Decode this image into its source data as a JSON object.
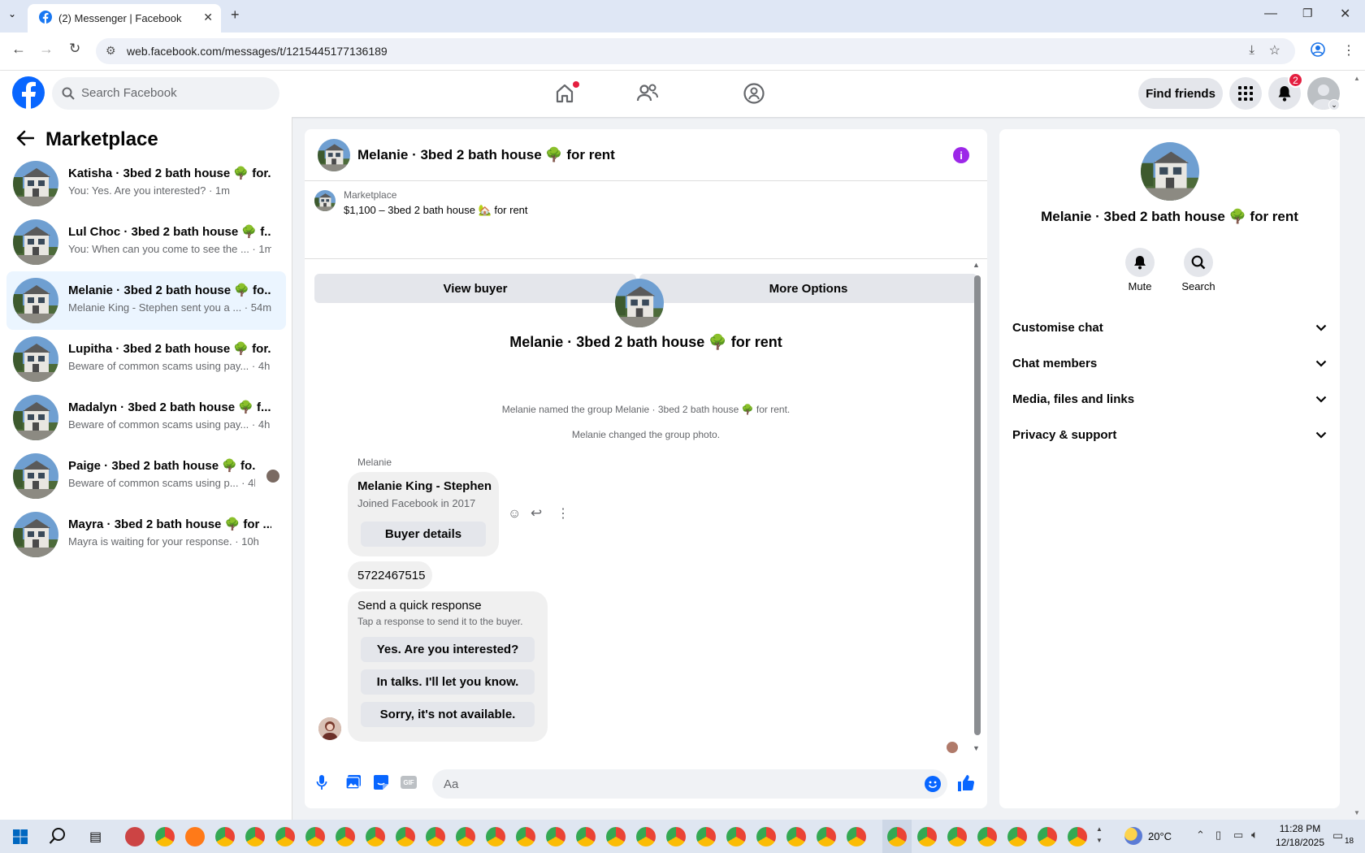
{
  "browser": {
    "tab_title": "(2) Messenger | Facebook",
    "url": "web.facebook.com/messages/t/1215445177136189"
  },
  "header": {
    "search_placeholder": "Search Facebook",
    "find_friends": "Find friends",
    "notification_count": "2"
  },
  "sidebar": {
    "title": "Marketplace",
    "conversations": [
      {
        "name": "Katisha · 3bed 2 bath house 🌳 for...",
        "preview": "You: Yes. Are you interested? · 1m"
      },
      {
        "name": "Lul Choc · 3bed 2 bath house 🌳 f...",
        "preview": "You: When can you come to see the ... · 1m"
      },
      {
        "name": "Melanie · 3bed 2 bath house 🌳 fo...",
        "preview": "Melanie King - Stephen sent you a ... · 54m"
      },
      {
        "name": "Lupitha · 3bed 2 bath house 🌳 for...",
        "preview": "Beware of common scams using pay... · 4h"
      },
      {
        "name": "Madalyn · 3bed 2 bath house 🌳 f...",
        "preview": "Beware of common scams using pay... · 4h"
      },
      {
        "name": "Paige · 3bed 2 bath house 🌳 fo...",
        "preview": "Beware of common scams using p... · 4h"
      },
      {
        "name": "Mayra · 3bed 2 bath house 🌳 for ...",
        "preview": "Mayra is waiting for your response. · 10h"
      }
    ]
  },
  "chat": {
    "title": "Melanie · 3bed 2 bath house 🌳 for rent",
    "listing_label": "Marketplace",
    "listing_title": "$1,100 – 3bed 2 bath house 🏡 for rent",
    "view_buyer": "View buyer",
    "more_options": "More Options",
    "system_messages": [
      "Melanie named the group Melanie · 3bed 2 bath house 🌳 for rent.",
      "Melanie changed the group photo."
    ],
    "sender": "Melanie",
    "card_name": "Melanie King - Stephen",
    "card_sub": "Joined Facebook in 2017",
    "card_button": "Buyer details",
    "phone": "5722467515",
    "quick_title": "Send a quick response",
    "quick_sub": "Tap a response to send it to the buyer.",
    "quick_replies": [
      "Yes. Are you interested?",
      "In talks. I'll let you know.",
      "Sorry, it's not available."
    ],
    "composer_placeholder": "Aa"
  },
  "details": {
    "name": "Melanie · 3bed 2 bath house 🌳 for rent",
    "mute": "Mute",
    "search": "Search",
    "sections": [
      "Customise chat",
      "Chat members",
      "Media, files and links",
      "Privacy & support"
    ]
  },
  "taskbar": {
    "weather": "20°C",
    "time": "11:28 PM",
    "date": "12/18/2025",
    "notifications": "18"
  },
  "colors": {
    "brand": "#1877f2",
    "info": "#9c27e8",
    "badge": "#e41e3f"
  }
}
